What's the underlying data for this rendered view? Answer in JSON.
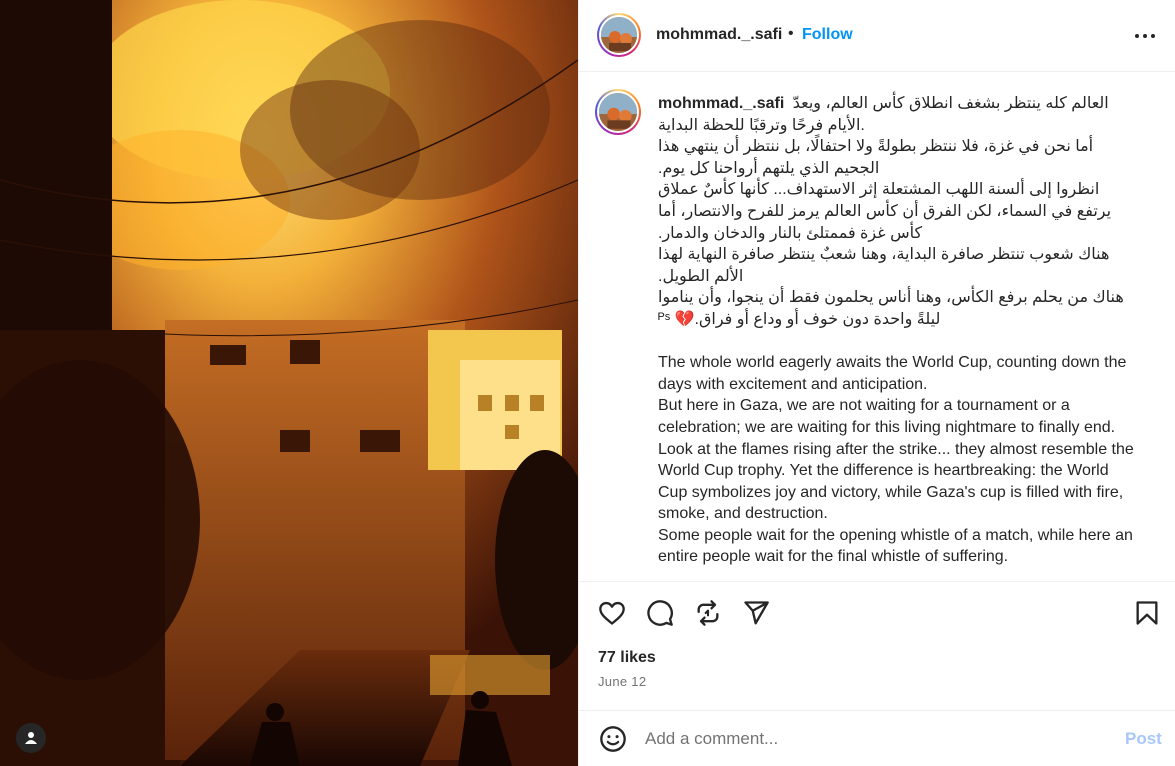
{
  "post": {
    "username": "mohmmad._.safi",
    "separator": "•",
    "follow_label": "Follow",
    "caption_username": "mohmmad._.safi",
    "caption_ar": [
      "العالم كله ينتظر بشغف انطلاق كأس العالم، ويعدّ الأيام فرحًا وترقبًا للحظة البداية.",
      "أما نحن في غزة، فلا ننتظر بطولةً ولا احتفالًا، بل ننتظر أن ينتهي هذا الجحيم الذي يلتهم أرواحنا كل يوم.",
      "انظروا إلى ألسنة اللهب المشتعلة إثر الاستهداف... كأنها كأسٌ عملاق يرتفع في السماء، لكن الفرق أن كأس العالم يرمز للفرح والانتصار، أما كأس غزة فممتلئ بالنار والدخان والدمار.",
      "هناك شعوب تنتظر صافرة البداية، وهنا شعبٌ ينتظر صافرة النهاية لهذا الألم الطويل.",
      "هناك من يحلم برفع الكأس، وهنا أناس يحلمون فقط أن ينجوا، وأن يناموا ليلةً واحدة دون خوف أو وداع أو فراق.💔 ᴾˢ"
    ],
    "caption_en": [
      "The whole world eagerly awaits the World Cup, counting down the days with excitement and anticipation.",
      "But here in Gaza, we are not waiting for a tournament or a celebration; we are waiting for this living nightmare to finally end.",
      "Look at the flames rising after the strike... they almost resemble the World Cup trophy. Yet the difference is heartbreaking: the World Cup symbolizes joy and victory, while Gaza's cup is filled with fire, smoke, and destruction.",
      "Some people wait for the opening whistle of a match, while here an entire people wait for the final whistle of suffering."
    ],
    "likes": "77 likes",
    "date": "June 12",
    "comment_placeholder": "Add a comment...",
    "post_label": "Post"
  },
  "icons": {
    "more": "more-options-icon",
    "like": "heart-icon",
    "comment": "comment-icon",
    "repost": "repost-icon",
    "share": "share-icon",
    "save": "bookmark-icon",
    "emoji": "emoji-icon",
    "tag": "user-tag-icon"
  },
  "colors": {
    "accent": "#0095f6",
    "post_disabled": "#a8c7fa",
    "secondary_text": "#737373",
    "border": "#efefef"
  }
}
